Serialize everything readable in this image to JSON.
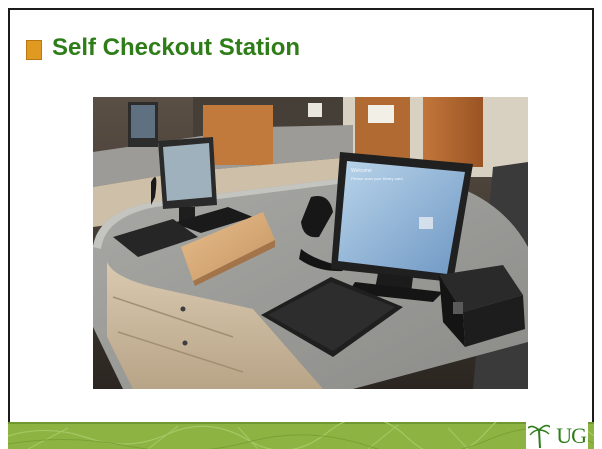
{
  "slide": {
    "title": "Self Checkout Station",
    "logo_text": "UG"
  },
  "colors": {
    "title": "#2e7d18",
    "title_marker": "#e09a22",
    "footer_band": "#8db342",
    "footer_band_dark": "#6f9830"
  },
  "photo": {
    "monitor_screen_text_line1": "Welcome",
    "monitor_screen_text_line2": "Please scan your library card"
  }
}
